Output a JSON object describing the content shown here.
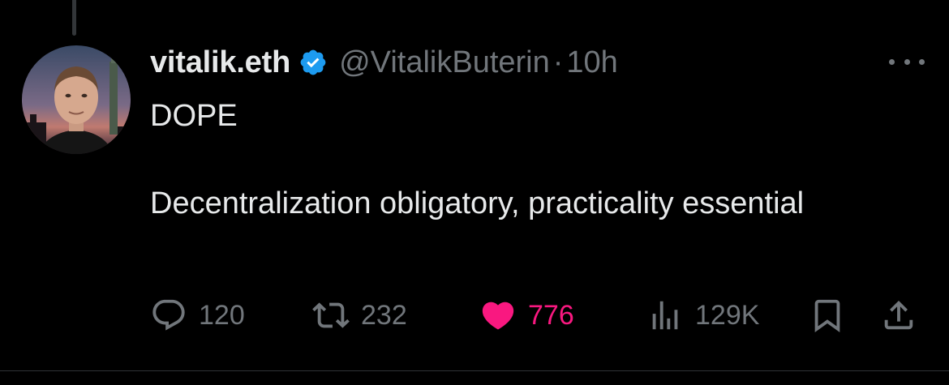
{
  "tweet": {
    "display_name": "vitalik.eth",
    "handle": "@VitalikButerin",
    "separator": "·",
    "time": "10h",
    "body_line_1": "DOPE",
    "body_line_2": "Decentralization obligatory, practicality essential",
    "verified_icon": "verified-badge-icon"
  },
  "actions": {
    "replies": "120",
    "reposts": "232",
    "likes": "776",
    "views": "129K",
    "liked": true
  },
  "colors": {
    "background": "#000000",
    "text_primary": "#e7e9ea",
    "text_secondary": "#71767b",
    "verified_blue": "#1d9bf0",
    "like_pink": "#f91880"
  }
}
